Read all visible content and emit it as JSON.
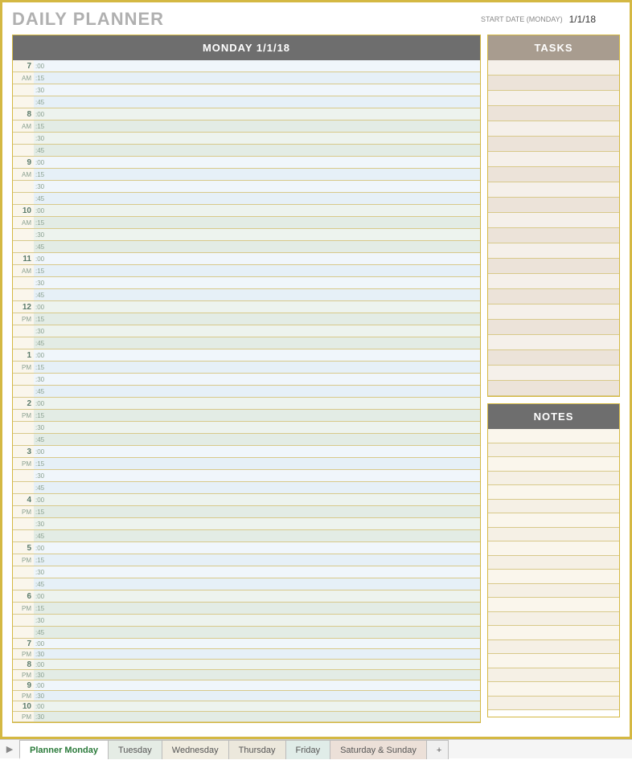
{
  "header": {
    "title": "DAILY PLANNER",
    "start_label": "START DATE (MONDAY)",
    "start_date": "1/1/18"
  },
  "schedule": {
    "header": "MONDAY 1/1/18",
    "minutes": [
      ":00",
      ":15",
      ":30",
      ":45"
    ],
    "minutes_short": [
      ":00",
      ":30"
    ],
    "hours": [
      {
        "hr": "7",
        "ap": "AM",
        "tone": "blue"
      },
      {
        "hr": "8",
        "ap": "AM",
        "tone": "green"
      },
      {
        "hr": "9",
        "ap": "AM",
        "tone": "blue"
      },
      {
        "hr": "10",
        "ap": "AM",
        "tone": "green"
      },
      {
        "hr": "11",
        "ap": "AM",
        "tone": "blue"
      },
      {
        "hr": "12",
        "ap": "PM",
        "tone": "green"
      },
      {
        "hr": "1",
        "ap": "PM",
        "tone": "blue"
      },
      {
        "hr": "2",
        "ap": "PM",
        "tone": "green"
      },
      {
        "hr": "3",
        "ap": "PM",
        "tone": "blue"
      },
      {
        "hr": "4",
        "ap": "PM",
        "tone": "green"
      },
      {
        "hr": "5",
        "ap": "PM",
        "tone": "blue"
      },
      {
        "hr": "6",
        "ap": "PM",
        "tone": "green"
      },
      {
        "hr": "7",
        "ap": "PM",
        "tone": "blue",
        "short": true
      },
      {
        "hr": "8",
        "ap": "PM",
        "tone": "green",
        "short": true
      },
      {
        "hr": "9",
        "ap": "PM",
        "tone": "blue",
        "short": true
      },
      {
        "hr": "10",
        "ap": "PM",
        "tone": "green",
        "short": true
      }
    ]
  },
  "tasks": {
    "header": "TASKS",
    "rows": 22
  },
  "notes": {
    "header": "NOTES",
    "rows": 20
  },
  "tabs": {
    "nav": "▶",
    "plus": "+",
    "items": [
      {
        "label": "Planner Monday",
        "active": true
      },
      {
        "label": "Tuesday"
      },
      {
        "label": "Wednesday"
      },
      {
        "label": "Thursday"
      },
      {
        "label": "Friday"
      },
      {
        "label": "Saturday & Sunday"
      }
    ]
  }
}
